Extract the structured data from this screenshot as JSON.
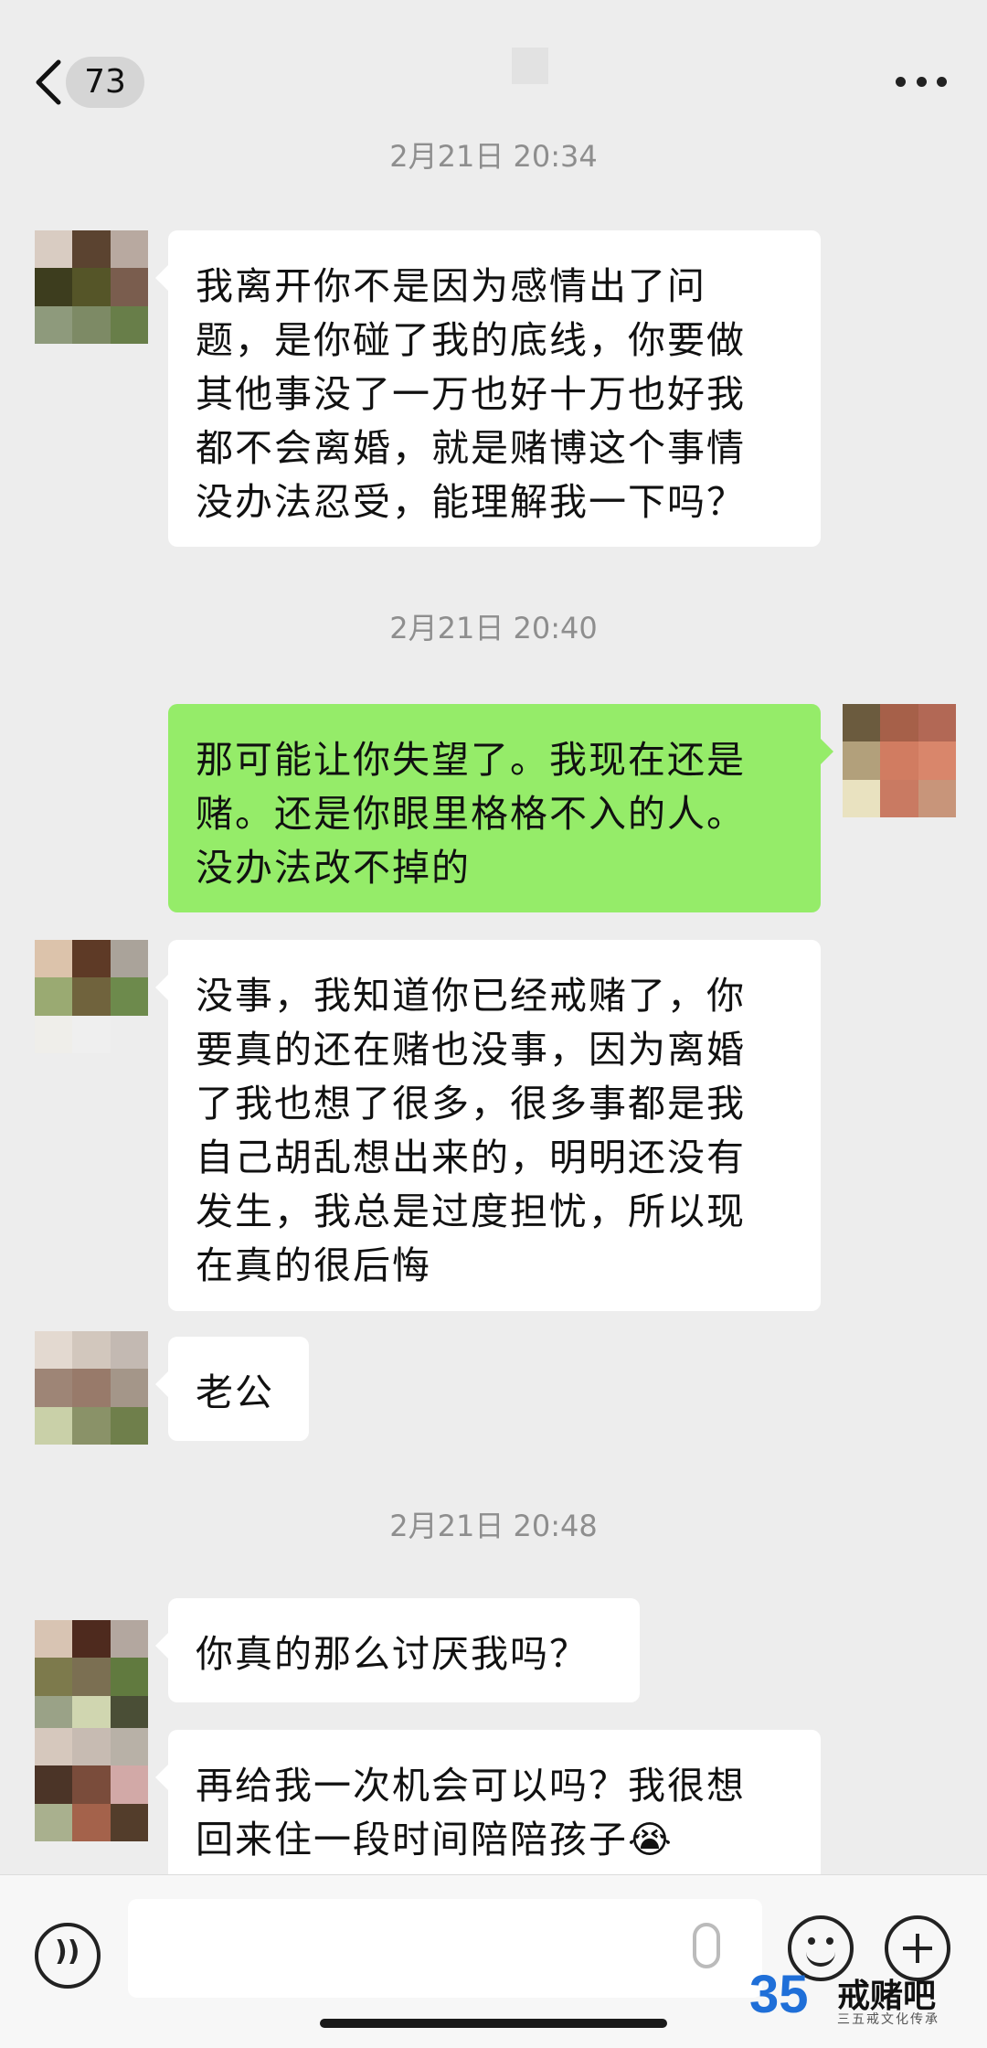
{
  "header": {
    "unread_count": "73"
  },
  "messages": [
    {
      "type": "timestamp",
      "text": "2月21日 20:34"
    },
    {
      "type": "received",
      "text": "我离开你不是因为感情出了问\n题，是你碰了我的底线，你要做\n其他事没了一万也好十万也好我\n都不会离婚，就是赌博这个事情\n没办法忍受，能理解我一下吗？"
    },
    {
      "type": "timestamp",
      "text": "2月21日 20:40"
    },
    {
      "type": "sent",
      "text": "那可能让你失望了。我现在还是\n赌。还是你眼里格格不入的人。\n没办法改不掉的"
    },
    {
      "type": "received",
      "text": "没事，我知道你已经戒赌了，你\n要真的还在赌也没事，因为离婚\n了我也想了很多，很多事都是我\n自己胡乱想出来的，明明还没有\n发生，我总是过度担忧，所以现\n在真的很后悔"
    },
    {
      "type": "received",
      "text": "老公"
    },
    {
      "type": "timestamp",
      "text": "2月21日 20:48"
    },
    {
      "type": "received",
      "text": "你真的那么讨厌我吗？"
    },
    {
      "type": "received",
      "text": "再给我一次机会可以吗？我很想\n回来住一段时间陪陪孩子😭"
    }
  ],
  "watermark": {
    "number": "35",
    "title": "戒赌吧",
    "subtitle": "三五戒文化传承"
  },
  "colors": {
    "sent_bubble": "#95ec69",
    "received_bubble": "#ffffff",
    "background": "#ededed"
  }
}
